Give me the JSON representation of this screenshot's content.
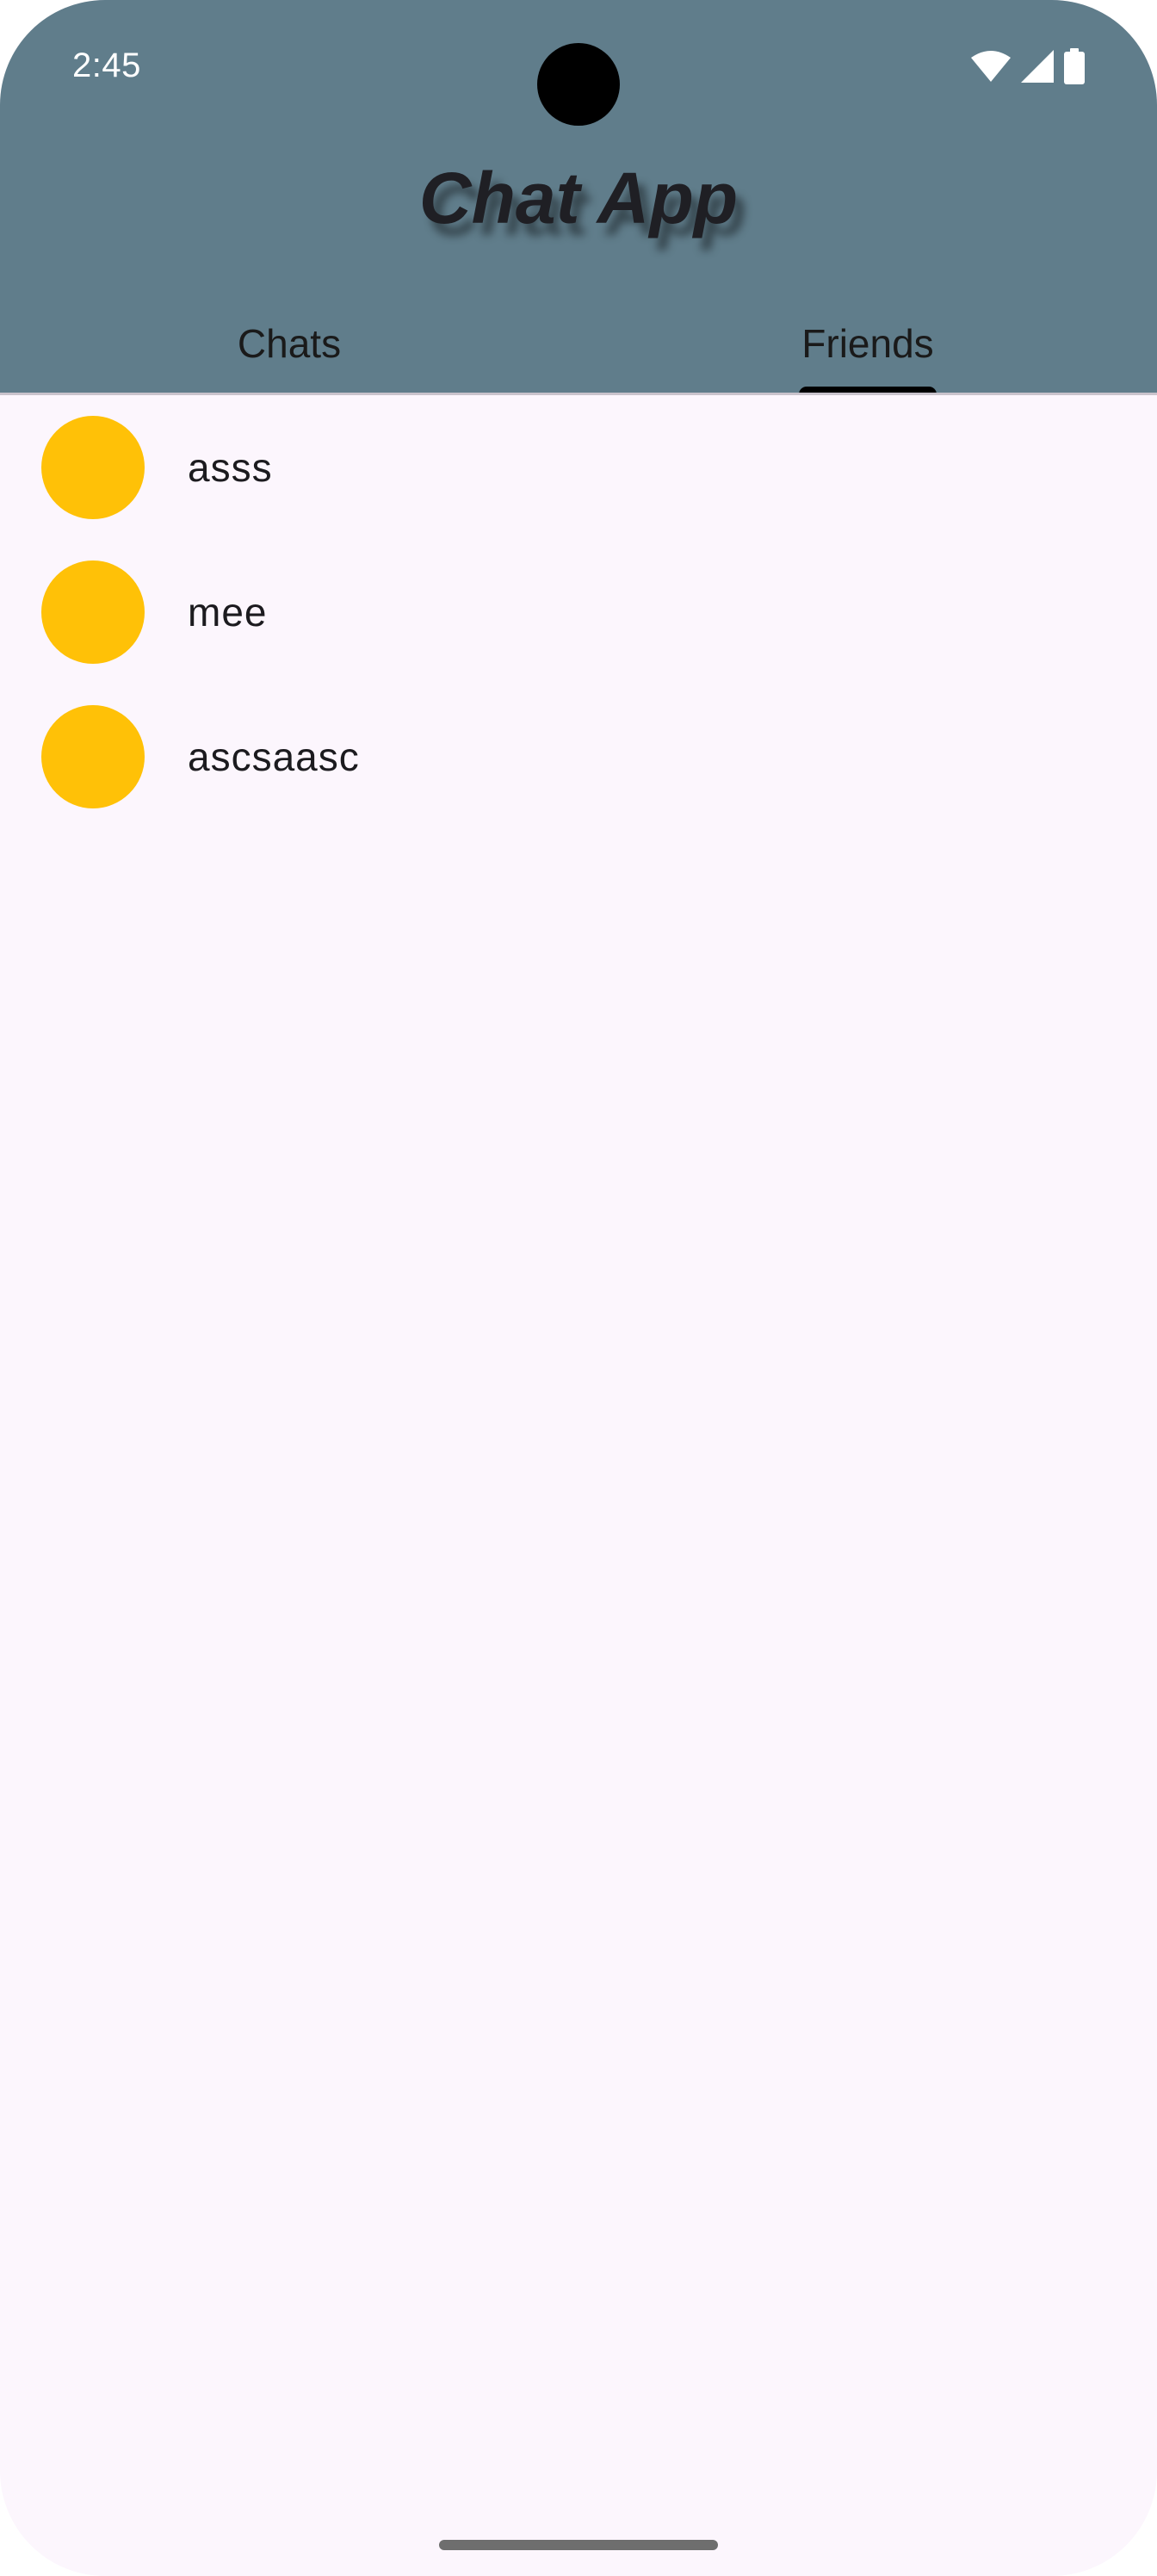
{
  "status_bar": {
    "time": "2:45",
    "icons": [
      "wifi-icon",
      "cell-signal-icon",
      "battery-icon"
    ]
  },
  "app_bar": {
    "title": "Chat App",
    "background": "#607d8b"
  },
  "tabs": [
    {
      "label": "Chats",
      "selected": false
    },
    {
      "label": "Friends",
      "selected": true
    }
  ],
  "friends": [
    {
      "name": "asss",
      "avatar_color": "#ffc107"
    },
    {
      "name": "mee",
      "avatar_color": "#ffc107"
    },
    {
      "name": "ascsaasc",
      "avatar_color": "#ffc107"
    }
  ]
}
